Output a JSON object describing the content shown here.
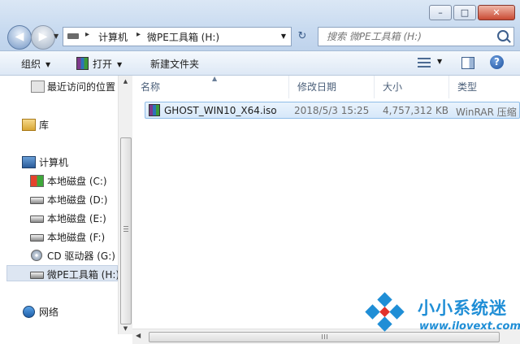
{
  "window": {
    "minimize_glyph": "–",
    "maximize_glyph": "□",
    "close_glyph": "✕"
  },
  "address": {
    "sep": "▸",
    "segments": [
      "计算机",
      "微PE工具箱 (H:)"
    ]
  },
  "search": {
    "placeholder": "搜索 微PE工具箱 (H:)"
  },
  "toolbar": {
    "organize": "组织",
    "open": "打开",
    "new_folder": "新建文件夹"
  },
  "nav": {
    "recent": "最近访问的位置",
    "library": "库",
    "computer": "计算机",
    "drive_c": "本地磁盘 (C:)",
    "drive_d": "本地磁盘 (D:)",
    "drive_e": "本地磁盘 (E:)",
    "drive_f": "本地磁盘 (F:)",
    "drive_g": "CD 驱动器 (G:)",
    "drive_h": "微PE工具箱 (H:)",
    "network": "网络",
    "selected": "drive_h"
  },
  "columns": {
    "name": "名称",
    "date": "修改日期",
    "size": "大小",
    "type": "类型"
  },
  "files": [
    {
      "name": "GHOST_WIN10_X64.iso",
      "date": "2018/5/3 15:25",
      "size": "4,757,312 KB",
      "type": "WinRAR 压缩"
    }
  ],
  "watermark": {
    "title": "小小系统迷",
    "url": "www.ilovext.com"
  },
  "colors": {
    "accent": "#1f8ed6",
    "selection": "#d6e8fa"
  }
}
